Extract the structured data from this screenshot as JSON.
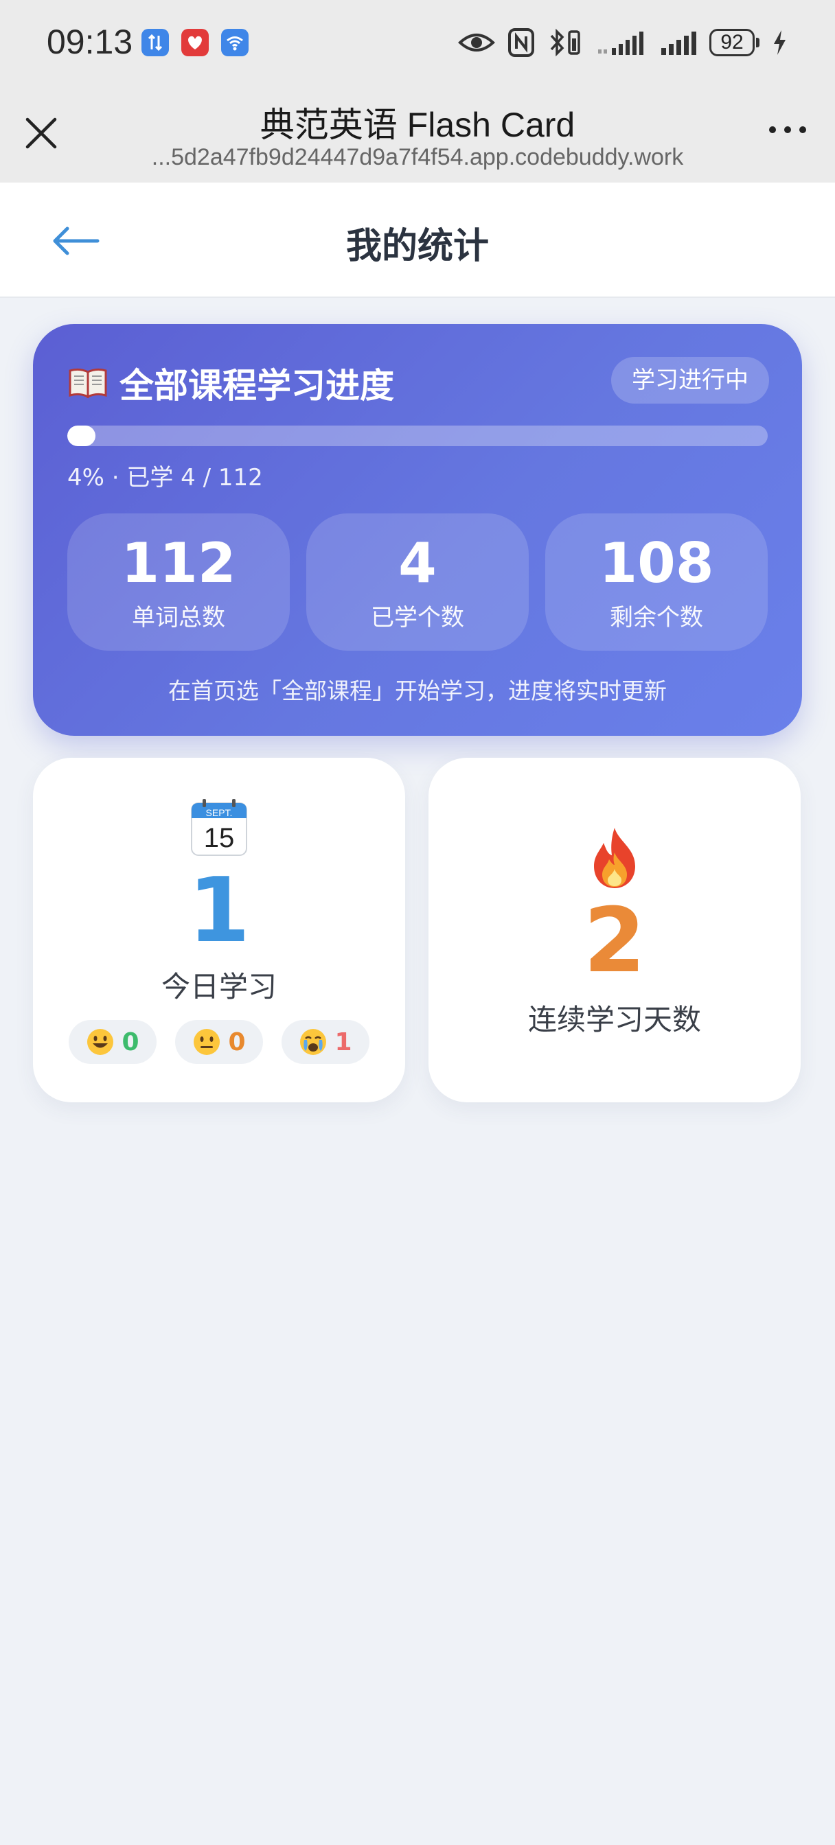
{
  "status_bar": {
    "time": "09:13",
    "battery": "92",
    "icons": [
      "data-transfer-icon",
      "app-notification-icon",
      "wifi-icon",
      "eye-icon",
      "nfc-icon",
      "bluetooth-icon",
      "signal-icon",
      "signal-icon",
      "charging-icon"
    ]
  },
  "browser": {
    "title": "典范英语 Flash Card",
    "url": "...5d2a47fb9d24447d9a7f4f54.app.codebuddy.work"
  },
  "header": {
    "title": "我的统计"
  },
  "progress_card": {
    "title": "全部课程学习进度",
    "badge": "学习进行中",
    "progress_percent": 4,
    "meta": "4% · 已学 4 / 112",
    "stats": [
      {
        "value": "112",
        "label": "单词总数"
      },
      {
        "value": "4",
        "label": "已学个数"
      },
      {
        "value": "108",
        "label": "剩余个数"
      }
    ],
    "hint": "在首页选「全部课程」开始学习，进度将实时更新",
    "colors": {
      "gradient_start": "#5b5fd3",
      "gradient_end": "#6a80ea"
    }
  },
  "today_card": {
    "calendar_month": "SEPT.",
    "calendar_day": "15",
    "value": "1",
    "label": "今日学习",
    "moods": [
      {
        "icon": "grinning-face-icon",
        "count": "0",
        "color": "#3dbb6c"
      },
      {
        "icon": "neutral-face-icon",
        "count": "0",
        "color": "#e8892e"
      },
      {
        "icon": "crying-face-icon",
        "count": "1",
        "color": "#ec6a6a"
      }
    ]
  },
  "streak_card": {
    "value": "2",
    "label": "连续学习天数"
  }
}
